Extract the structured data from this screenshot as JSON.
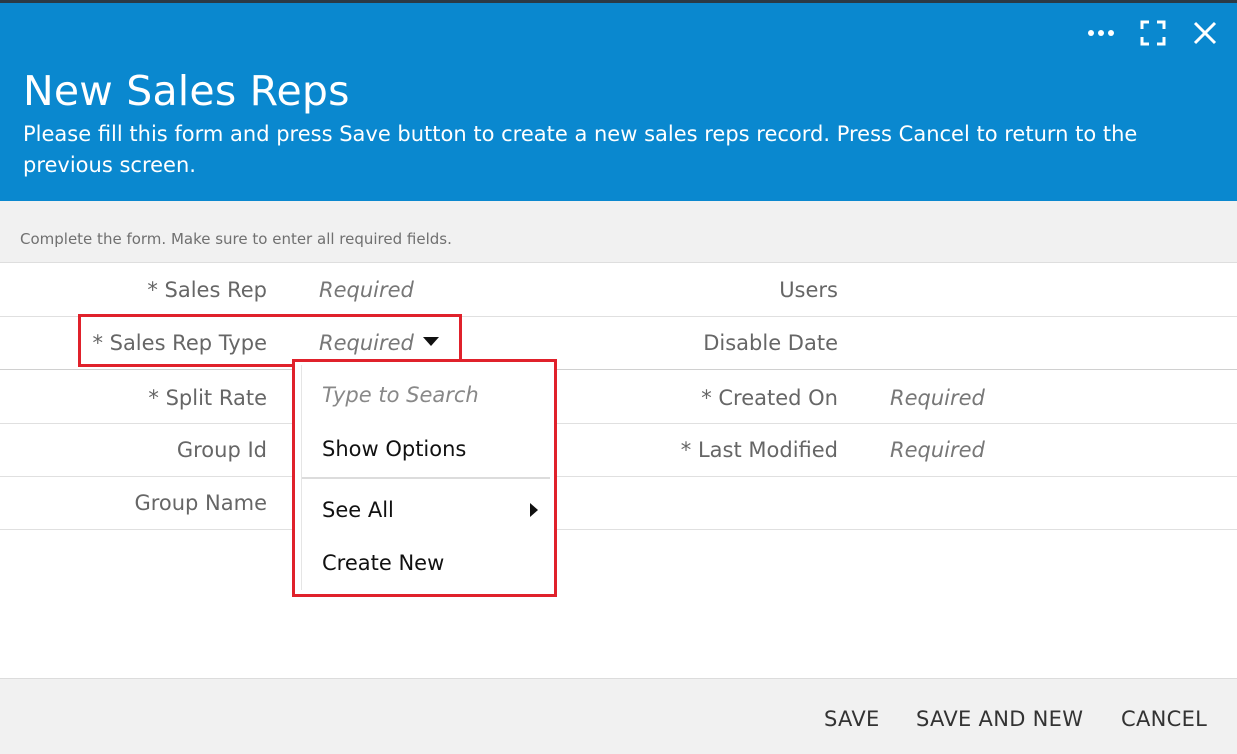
{
  "header": {
    "title": "New Sales Reps",
    "description": "Please fill this form and press Save button to create a new sales reps record. Press Cancel to return to the previous screen.",
    "icons": [
      "more-icon",
      "expand-icon",
      "close-icon"
    ]
  },
  "form": {
    "instructions": "Complete the form. Make sure to enter all required fields.",
    "left_fields": [
      {
        "label": "* Sales Rep",
        "value": "Required"
      },
      {
        "label": "* Sales Rep Type",
        "value": "Required"
      },
      {
        "label": "* Split Rate",
        "value": ""
      },
      {
        "label": "Group Id",
        "value": ""
      },
      {
        "label": "Group Name",
        "value": ""
      }
    ],
    "right_fields": [
      {
        "label": "Users",
        "value": ""
      },
      {
        "label": "Disable Date",
        "value": ""
      },
      {
        "label": "* Created On",
        "value": "Required"
      },
      {
        "label": "* Last Modified",
        "value": "Required"
      }
    ]
  },
  "dropdown": {
    "search_placeholder": "Type to Search",
    "items": [
      "Show Options",
      "See All",
      "Create New"
    ]
  },
  "footer": {
    "save": "SAVE",
    "save_and_new": "SAVE AND NEW",
    "cancel": "CANCEL"
  },
  "colors": {
    "header_bg": "#0a88cf",
    "highlight": "#e0212b"
  }
}
